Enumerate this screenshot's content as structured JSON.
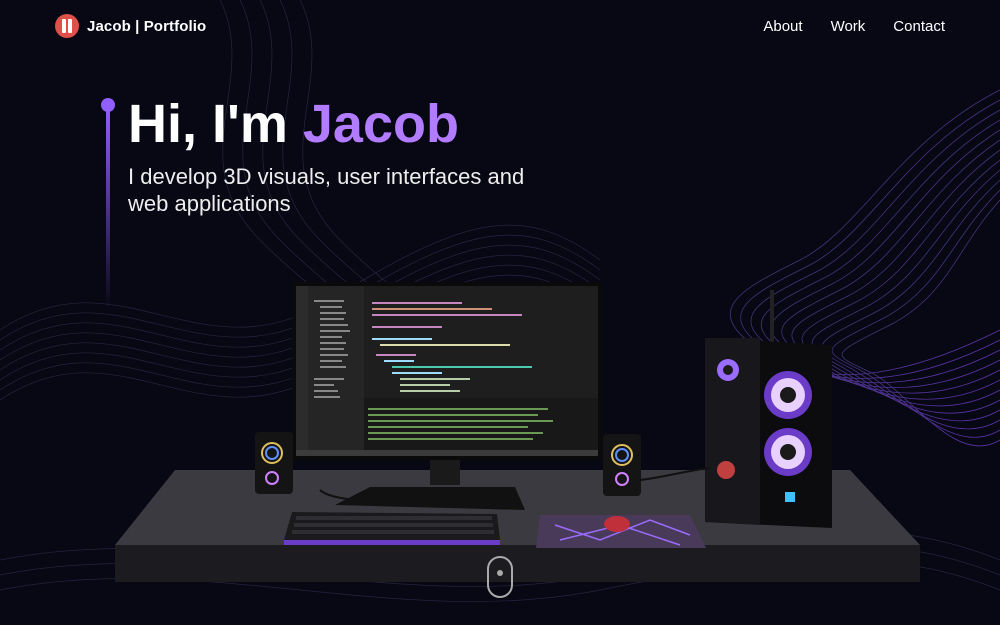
{
  "nav": {
    "brand_name": "Jacob",
    "brand_suffix": "| Portfolio",
    "links": [
      "About",
      "Work",
      "Contact"
    ]
  },
  "hero": {
    "greeting": "Hi, I'm ",
    "name": "Jacob",
    "subtitle": "I develop 3D visuals, user interfaces and web applications"
  },
  "colors": {
    "background": "#080714",
    "accent": "#915eff",
    "name_accent": "#b17cff",
    "logo": "#e0504a"
  },
  "scene": {
    "description_icon": "desk-setup-3d"
  }
}
